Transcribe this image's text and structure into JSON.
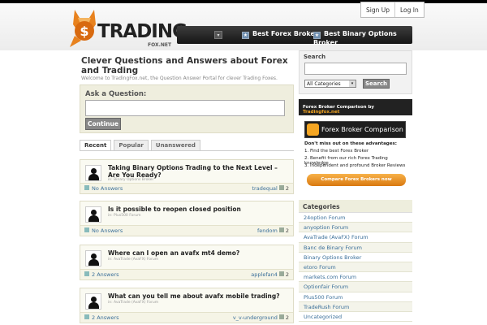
{
  "header": {
    "brand": "TRADING",
    "brand_sub": "FOX.NET",
    "auth": {
      "signup": "Sign Up",
      "login": "Log In"
    },
    "nav": {
      "drop_glyph": "▾",
      "items": [
        {
          "label": "Best Forex Broker",
          "icon": "star-icon"
        },
        {
          "label": "Best Binary Options Broker",
          "icon": "star-icon"
        }
      ]
    }
  },
  "main": {
    "title": "Clever Questions and Answers about Forex and Trading",
    "welcome": "Welcome to TradingFox.net, the Question Answer Portal for clever Trading Foxes.",
    "ask": {
      "label": "Ask a Question:",
      "button": "Continue"
    },
    "tabs": [
      "Recent",
      "Popular",
      "Unanswered"
    ],
    "questions": [
      {
        "title": "Taking Binary Options Trading to the Next Level – Are You Ready?",
        "category": "in: Binary Options Broker",
        "answers": "No Answers",
        "user": "tradequal",
        "votes": "2"
      },
      {
        "title": "Is it possible to reopen closed position",
        "category": "in: Plus500 Forum",
        "answers": "No Answers",
        "user": "fendom",
        "votes": "2"
      },
      {
        "title": "Where can I open an avafx mt4 demo?",
        "category": "in: AvaTrade (AvaFX) Forum",
        "answers": "2 Answers",
        "user": "applefan4",
        "votes": "2"
      },
      {
        "title": "What can you tell me about avafx mobile trading?",
        "category": "in: AvaTrade (AvaFX) Forum",
        "answers": "2 Answers",
        "user": "v_v-underground",
        "votes": "2"
      }
    ]
  },
  "sidebar": {
    "search": {
      "heading": "Search",
      "select_value": "All Categories",
      "button": "Search"
    },
    "ad": {
      "strip": "Forex Broker Comparison by ",
      "strip_brand": "Tradingfox.net",
      "banner": "Forex Broker Comparison",
      "lead": "Don't miss out on these advantages:",
      "points": [
        "1. Find the best Forex Broker",
        "2. Benefit from our rich Forex Trading knowledge",
        "3. Independent and profound Broker Reviews"
      ],
      "cta": "Compare Forex Brokers now"
    },
    "categories": {
      "heading": "Categories",
      "items": [
        "24option Forum",
        "anyoption Forum",
        "AvaTrade (AvaFX) Forum",
        "Banc de Binary Forum",
        "Binary Options Broker",
        "etoro Forum",
        "markets.com Forum",
        "Optionfair Forum",
        "Plus500 Forum",
        "TradeRush Forum",
        "Uncategorized"
      ]
    }
  }
}
